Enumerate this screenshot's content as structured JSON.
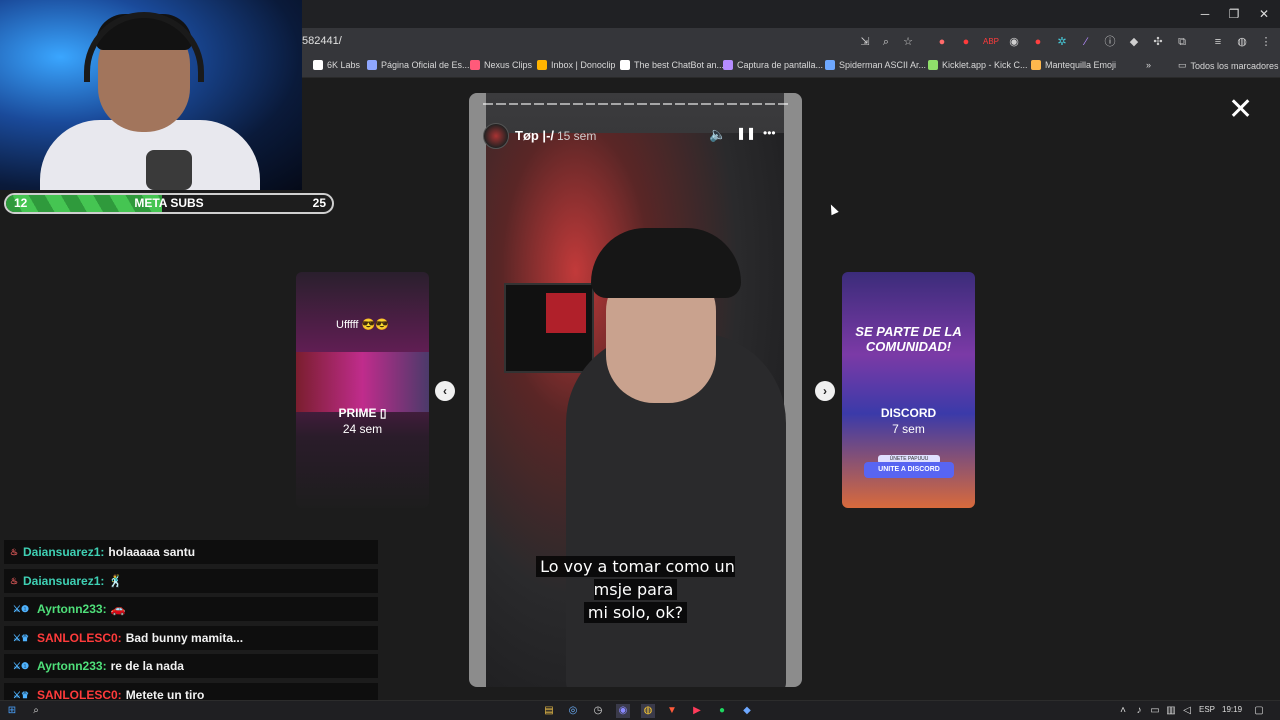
{
  "browser": {
    "url": "582441/",
    "window_controls": [
      "minimize",
      "restore",
      "close"
    ],
    "toolbar_icons": [
      "install-icon",
      "zoom-icon",
      "star-icon",
      "ext-1-icon",
      "ext-2-icon",
      "abp-icon",
      "ext-4-icon",
      "ext-5-icon",
      "ext-6-icon",
      "ext-7-icon",
      "ext-8-icon",
      "ext-9-icon",
      "ext-10-icon",
      "extensions-icon",
      "menu-list-icon",
      "profile-icon",
      "kebab-icon"
    ],
    "bookmarks": [
      {
        "label": "6K Labs",
        "color": "#ffffff"
      },
      {
        "label": "Página Oficial de Es...",
        "color": "#8fa7ff"
      },
      {
        "label": "Nexus Clips",
        "color": "#ff5a7a"
      },
      {
        "label": "Inbox | Donoclip",
        "color": "#ffb400"
      },
      {
        "label": "The best ChatBot an...",
        "color": "#ffffff"
      },
      {
        "label": "Captura de pantalla...",
        "color": "#b58cff"
      },
      {
        "label": "Spiderman ASCII Ar...",
        "color": "#6ea8ff"
      },
      {
        "label": "Kicklet.app - Kick C...",
        "color": "#8fdf6a"
      },
      {
        "label": "Mantequilla Emoji",
        "color": "#ffb84d"
      }
    ],
    "more_bookmarks": "»",
    "all_bookmarks": "Todos los marcadores"
  },
  "viewer": {
    "close_glyph": "✕",
    "prev_glyph": "‹",
    "next_glyph": "›",
    "main_story": {
      "username": "Tøp |-/",
      "time": "15 sem",
      "subtitle_line1": "Lo voy a tomar como un msje para",
      "subtitle_line2": "mi solo, ok?",
      "progress_segments": 24,
      "mute_glyph": "🔈",
      "pause_glyph": "❚❚",
      "more_glyph": "•••"
    },
    "left_story": {
      "caption": "Ufffff 😎😎",
      "name": "PRIME ▯",
      "time": "24 sem"
    },
    "right_story": {
      "headline": "SE PARTE DE LA COMUNIDAD!",
      "name": "DISCORD",
      "time": "7 sem",
      "pill": "ÚNETE PAPUUU",
      "button": "UNITE A DISCORD"
    }
  },
  "overlay": {
    "meta": {
      "current": "12",
      "label": "META SUBS",
      "goal": "25",
      "progress": 0.48
    },
    "chat": [
      {
        "badge": "♨",
        "badge_color": "#e05a5a",
        "user": "Daiansuarez1:",
        "user_color": "#3fd0b4",
        "message": "holaaaaa santu"
      },
      {
        "badge": "♨",
        "badge_color": "#e05a5a",
        "user": "Daiansuarez1:",
        "user_color": "#3fd0b4",
        "message": "🕺"
      },
      {
        "badge": "⚔❶",
        "badge_color": "#4fb3ff",
        "user": "Ayrtonn233:",
        "user_color": "#4fe07a",
        "message": "🚗"
      },
      {
        "badge": "⚔♛",
        "badge_color": "#4fb3ff",
        "user": "SANLOLESC0:",
        "user_color": "#ff3b3b",
        "message": "Bad bunny mamita..."
      },
      {
        "badge": "⚔❶",
        "badge_color": "#4fb3ff",
        "user": "Ayrtonn233:",
        "user_color": "#4fe07a",
        "message": "re de la nada"
      },
      {
        "badge": "⚔♛",
        "badge_color": "#4fb3ff",
        "user": "SANLOLESC0:",
        "user_color": "#ff3b3b",
        "message": "Metete un tiro"
      }
    ]
  },
  "taskbar": {
    "language": "ESP",
    "time": "19:19"
  }
}
